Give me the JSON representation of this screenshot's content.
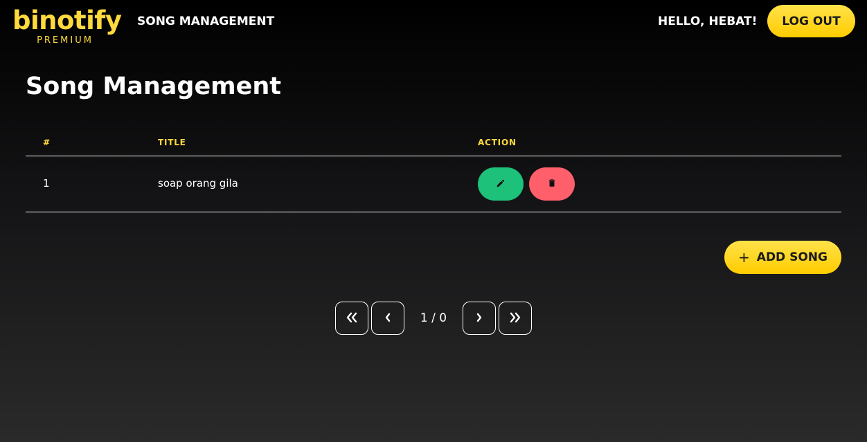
{
  "header": {
    "logo_text": "binotify",
    "logo_sub": "PREMIUM",
    "nav_label": "SONG MANAGEMENT",
    "greeting": "HELLO, HEBAT!",
    "logout_label": "LOG OUT"
  },
  "page": {
    "title": "Song Management"
  },
  "table": {
    "columns": [
      "#",
      "TITLE",
      "ACTION"
    ],
    "rows": [
      {
        "num": "1",
        "title": "soap orang gila"
      }
    ]
  },
  "actions": {
    "add_song_icon": "+",
    "add_song_label": "ADD SONG",
    "edit_icon": "pencil-icon",
    "delete_icon": "trash-icon"
  },
  "pagination": {
    "info": "1 / 0"
  },
  "colors": {
    "accent": "#ffd93d",
    "edit": "#1ec17a",
    "delete": "#ff5f6b"
  }
}
